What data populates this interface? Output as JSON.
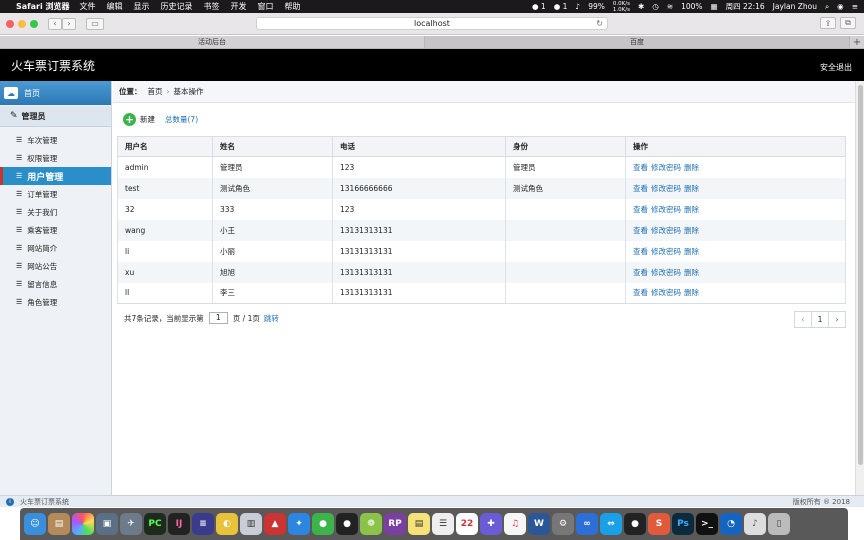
{
  "menubar": {
    "app_name": "Safari 浏览器",
    "items": [
      "文件",
      "编辑",
      "显示",
      "历史记录",
      "书签",
      "开发",
      "窗口",
      "帮助"
    ],
    "status": {
      "battery": "99%",
      "net_up": "0.0K/s",
      "net_down": "1.0K/s",
      "battery2": "100%",
      "clock": "周四 22:16",
      "user": "Jaylan Zhou",
      "qq_count": "1",
      "wechat_count": "1"
    }
  },
  "browser": {
    "url": "localhost",
    "tabs": [
      "活动后台",
      "百度"
    ]
  },
  "app": {
    "title": "火车票订票系统",
    "logout": "安全退出"
  },
  "sidebar": {
    "home": "首页",
    "group": "管理员",
    "items": [
      "车次管理",
      "权限管理",
      "用户管理",
      "订单管理",
      "关于我们",
      "乘客管理",
      "网站简介",
      "网站公告",
      "留言信息",
      "角色管理"
    ],
    "active_index": 2
  },
  "breadcrumb": {
    "label": "位置：",
    "home": "首页",
    "current": "基本操作"
  },
  "actions": {
    "new_label": "新建",
    "total_label": "总数量(7)"
  },
  "table": {
    "headers": [
      "用户名",
      "姓名",
      "电话",
      "身份",
      "操作"
    ],
    "op_labels": [
      "查看",
      "修改密码",
      "删除"
    ],
    "rows": [
      [
        "admin",
        "管理员",
        "123",
        "管理员"
      ],
      [
        "test",
        "测试角色",
        "13166666666",
        "测试角色"
      ],
      [
        "32",
        "333",
        "123",
        ""
      ],
      [
        "wang",
        "小王",
        "13131313131",
        ""
      ],
      [
        "li",
        "小丽",
        "13131313131",
        ""
      ],
      [
        "xu",
        "旭旭",
        "13131313131",
        ""
      ],
      [
        "ll",
        "李三",
        "13131313131",
        ""
      ]
    ]
  },
  "pager": {
    "summary": "共7条记录，当前显示第",
    "page_value": "1",
    "total_pages": "页 / 1页",
    "goto": "跳转",
    "current": "1"
  },
  "footer": {
    "left": "火车票订票系统",
    "right": "版权所有 ® 2018"
  }
}
